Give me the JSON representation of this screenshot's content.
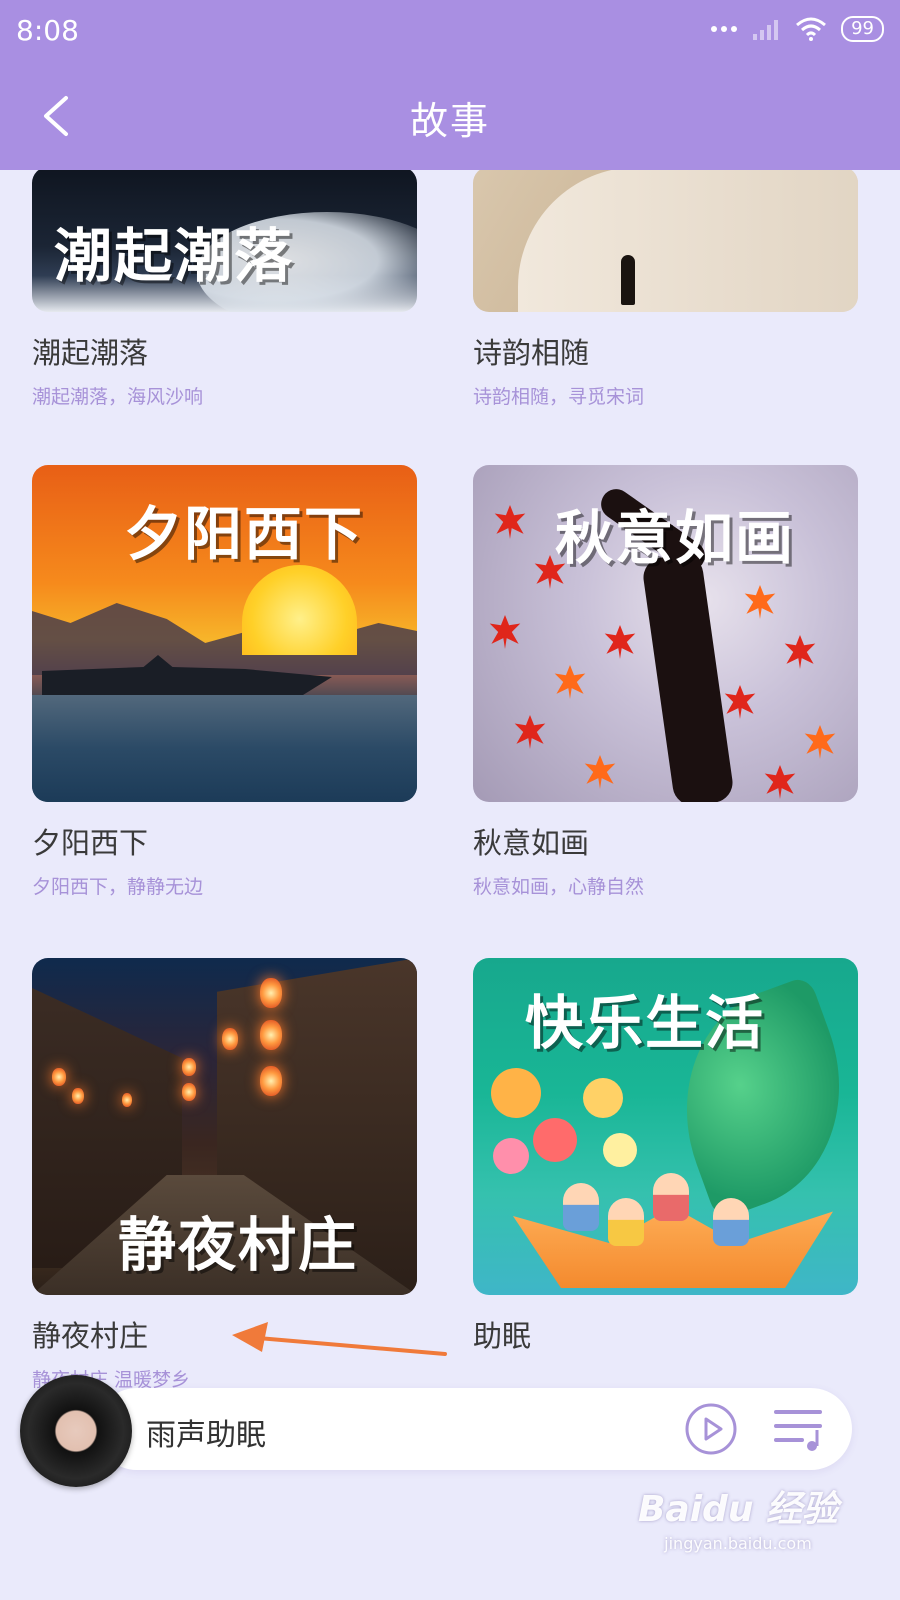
{
  "status_bar": {
    "time": "8:08",
    "battery": "99"
  },
  "header": {
    "title": "故事"
  },
  "cards": [
    {
      "thumb_text": "潮起潮落",
      "title": "潮起潮落",
      "subtitle": "潮起潮落，海风沙响"
    },
    {
      "thumb_text": "",
      "title": "诗韵相随",
      "subtitle": "诗韵相随，寻觅宋词"
    },
    {
      "thumb_text": "夕阳西下",
      "title": "夕阳西下",
      "subtitle": "夕阳西下，静静无边"
    },
    {
      "thumb_text": "秋意如画",
      "title": "秋意如画",
      "subtitle": "秋意如画，心静自然"
    },
    {
      "thumb_text": "静夜村庄",
      "title": "静夜村庄",
      "subtitle": "静夜村庄 温暖梦乡"
    },
    {
      "thumb_text": "快乐生活",
      "title": "助眠",
      "subtitle": ""
    }
  ],
  "player": {
    "track_title": "雨声助眠"
  },
  "watermark": {
    "logo": "Baidu 经验",
    "url": "jingyan.baidu.com"
  },
  "colors": {
    "header": "#a98fe2",
    "background": "#eaeafb",
    "accent": "#a792d8",
    "annotation_arrow": "#f07a3a"
  }
}
